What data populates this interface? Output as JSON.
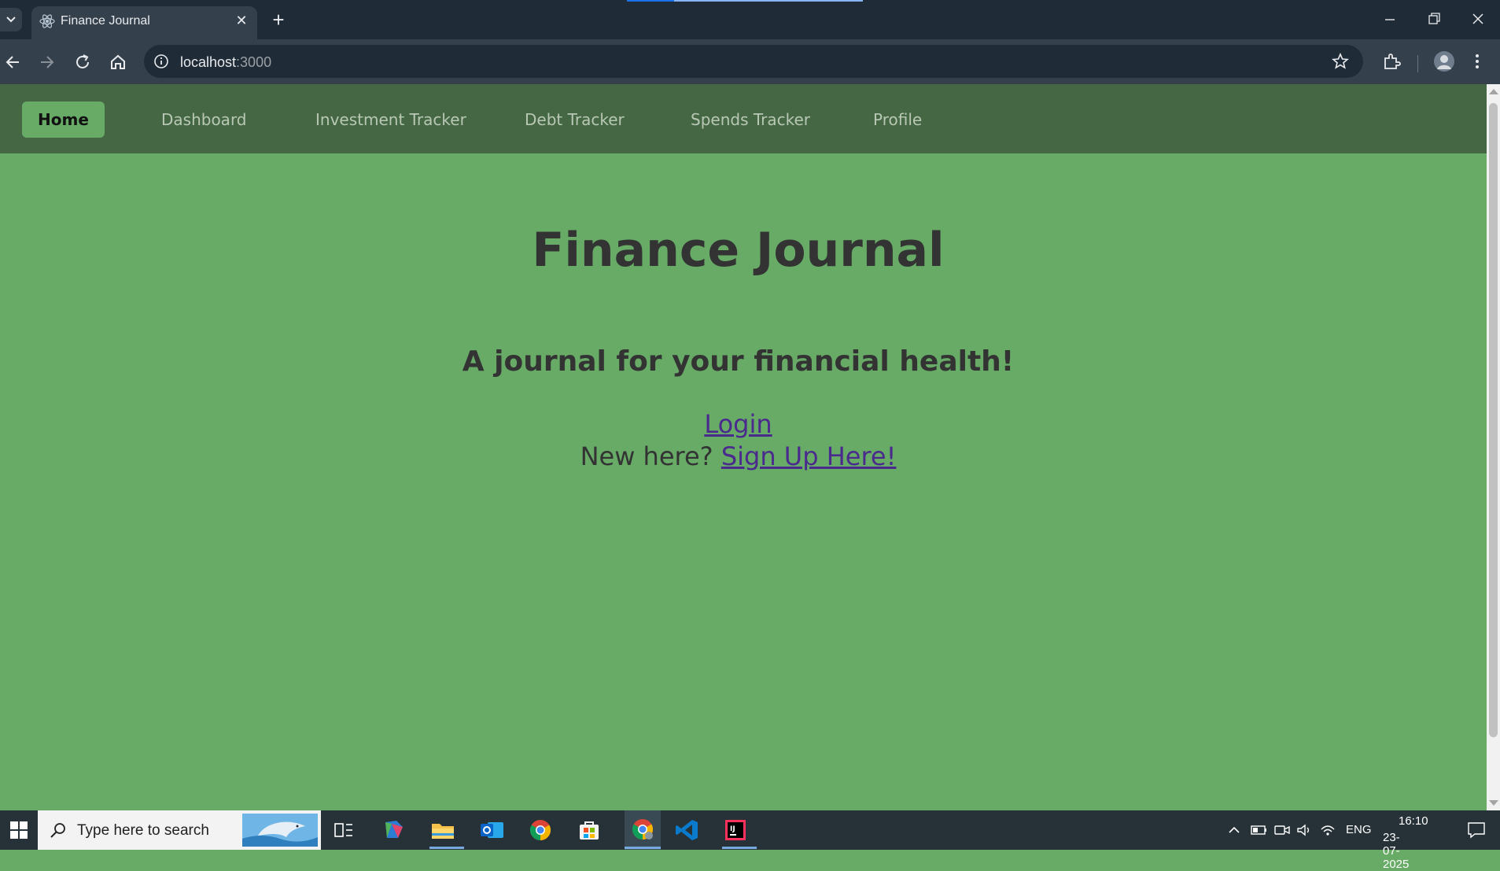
{
  "browser": {
    "tab_title": "Finance Journal",
    "url_host": "localhost",
    "url_port": ":3000"
  },
  "navbar": {
    "items": [
      {
        "label": "Home",
        "active": true
      },
      {
        "label": "Dashboard"
      },
      {
        "label": "Investment Tracker"
      },
      {
        "label": "Debt Tracker"
      },
      {
        "label": "Spends Tracker"
      },
      {
        "label": "Profile"
      }
    ]
  },
  "hero": {
    "title": "Finance Journal",
    "subtitle": "A journal for your financial health!",
    "login_link": "Login",
    "signup_prompt": "New here?",
    "signup_link": "Sign Up Here!"
  },
  "taskbar": {
    "search_placeholder": "Type here to search",
    "language": "ENG",
    "time": "16:10",
    "date": "23-07-2025"
  },
  "colors": {
    "page_bg": "#67ab67",
    "navbar_bg": "#456744",
    "link": "#4b2a8e",
    "heading": "#333333"
  }
}
